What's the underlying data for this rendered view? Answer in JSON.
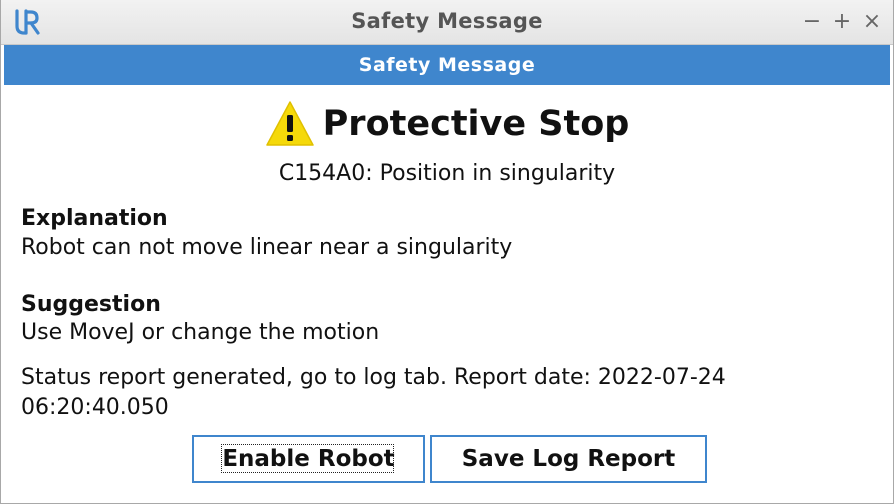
{
  "window": {
    "title": "Safety Message",
    "logo_icon": "ur-logo-icon",
    "controls": {
      "minimize": "−",
      "maximize": "+",
      "close": "×"
    }
  },
  "dialog": {
    "header": "Safety Message",
    "heading": "Protective Stop",
    "heading_icon": "warning-icon",
    "error_code": "C154A0: Position in singularity",
    "explanation_title": "Explanation",
    "explanation_text": "Robot can not move linear near a singularity",
    "suggestion_title": "Suggestion",
    "suggestion_text": "Use MoveJ or change the motion",
    "status_line1": "Status report generated, go to log tab. Report date: 2022-07-24",
    "status_line2": "06:20:40.050"
  },
  "buttons": {
    "enable_robot": "Enable Robot",
    "save_log_report": "Save Log Report"
  },
  "colors": {
    "accent": "#3f86cd",
    "warning": "#f5d90a"
  }
}
